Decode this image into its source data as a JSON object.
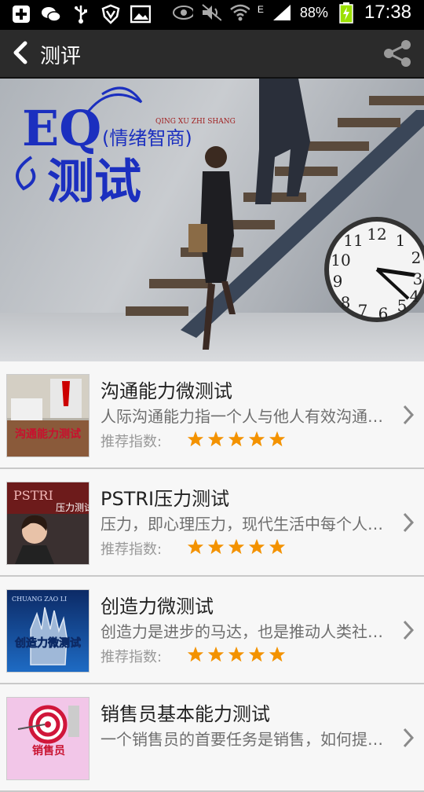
{
  "status_bar": {
    "battery": "88%",
    "network": "E",
    "time": "17:38",
    "icons_left": [
      "add-icon",
      "wechat-icon",
      "usb-icon",
      "shield-icon",
      "image-icon"
    ],
    "icons_right": [
      "eye-icon",
      "mute-icon",
      "wifi-icon",
      "signal-icon",
      "battery-icon"
    ]
  },
  "header": {
    "title": "测评",
    "back_icon": "back-arrow-icon",
    "share_icon": "share-icon"
  },
  "banner": {
    "title_big": "EQ",
    "pinyin": "QING XU ZHI SHANG",
    "subtitle": "(情绪智商)",
    "title_cn": "测试"
  },
  "list": {
    "rating_label": "推荐指数:",
    "items": [
      {
        "title": "沟通能力微测试",
        "desc": "人际沟通能力指一个人与他人有效沟通信息的能力",
        "stars": 5,
        "thumb_text": "沟通能力测试"
      },
      {
        "title": "PSTRI压力测试",
        "desc": "压力，即心理压力，现代生活中每个人都会面临",
        "stars": 5,
        "thumb_brand": "PSTRI",
        "thumb_text": "压力测试"
      },
      {
        "title": "创造力微测试",
        "desc": "创造力是进步的马达，也是推动人类社会前进的动力",
        "stars": 5,
        "thumb_top": "CHUANG ZAO LI",
        "thumb_text": "创造力微测试"
      },
      {
        "title": "销售员基本能力测试",
        "desc": "一个销售员的首要任务是销售，如何提升能力",
        "stars": 5,
        "thumb_text": "销售员"
      }
    ]
  },
  "colors": {
    "accent_star": "#f39200",
    "titlebar": "#2b2b2b",
    "banner_blue": "#1b2fbf"
  }
}
